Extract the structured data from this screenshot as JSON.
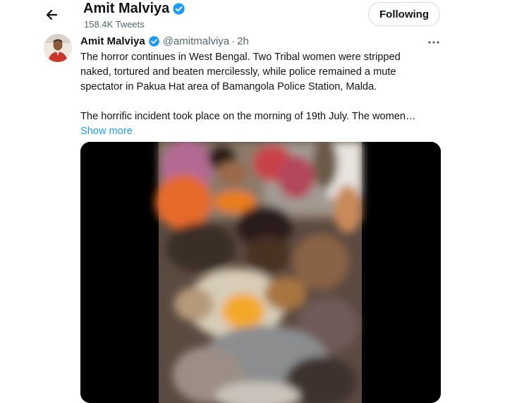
{
  "header": {
    "title": "Amit Malviya",
    "tweet_count": "158.4K Tweets",
    "follow_label": "Following"
  },
  "tweet": {
    "author_name": "Amit Malviya",
    "handle": "@amitmalviya",
    "separator": "·",
    "time": "2h",
    "paragraph1": "The horror continues in West Bengal. Two Tribal women were stripped naked, tortured and beaten mercilessly, while police remained a mute spectator in Pakua Hat area of Bamangola Police Station, Malda.",
    "paragraph2": "The horrific incident took place on the morning of 19th July. The women…",
    "show_more": "Show more"
  },
  "icons": {
    "back": "arrow-left-icon",
    "verified": "verified-badge-icon",
    "more": "more-horizontal-icon"
  },
  "colors": {
    "accent": "#1d9bf0",
    "text": "#0f1419",
    "secondary": "#536471"
  }
}
